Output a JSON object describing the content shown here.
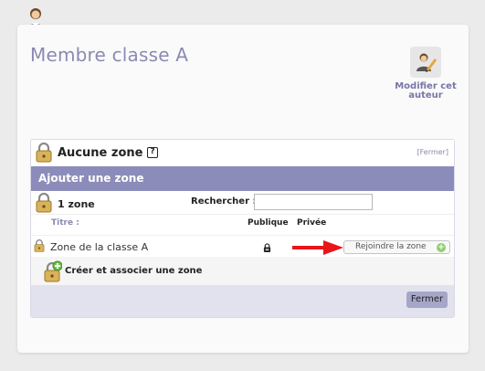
{
  "page": {
    "title": "Membre classe A",
    "edit_author_label": "Modifier cet auteur"
  },
  "panel": {
    "title": "Aucune zone",
    "close_link": "[Fermer]",
    "add_zone_label": "Ajouter une zone",
    "count_label": "1 zone",
    "search_label": "Rechercher :",
    "search_value": "",
    "columns": {
      "title": "Titre :",
      "public": "Publique",
      "private": "Privée"
    },
    "zones": [
      {
        "name": "Zone de la classe A",
        "access": "private",
        "join_label": "Rejoindre la zone"
      }
    ],
    "create_label": "Créer et associer une zone",
    "close_button": "Fermer"
  },
  "icons": {
    "avatar": "author-icon",
    "edit": "author-edit-icon",
    "lock": "padlock-icon",
    "help": "help-icon",
    "add": "padlock-add-icon",
    "arrow": "red-arrow-icon"
  },
  "colors": {
    "title": "#8a8ab4",
    "accent_bar": "#8c8cba",
    "footer": "#e2e2ee",
    "close_button": "#a6a6c8",
    "arrow": "#e8151a"
  }
}
